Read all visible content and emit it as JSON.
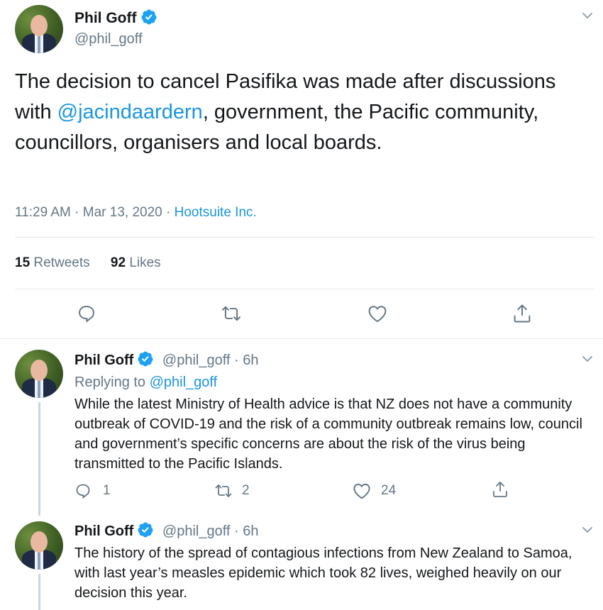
{
  "main_tweet": {
    "author_name": "Phil Goff",
    "handle": "@phil_goff",
    "text_before": "The decision to cancel Pasifika was made after discussions with ",
    "mention": "@jacindaardern",
    "text_after": ", government, the Pacific community, councillors, organisers and local boards.",
    "time": "11:29 AM",
    "date": "Mar 13, 2020",
    "separator": "·",
    "source": "Hootsuite Inc.",
    "retweets_count": "15",
    "retweets_label": "Retweets",
    "likes_count": "92",
    "likes_label": "Likes"
  },
  "replies": [
    {
      "author_name": "Phil Goff",
      "handle": "@phil_goff",
      "dot": "·",
      "age": "6h",
      "replying_label": "Replying to",
      "replying_handle": "@phil_goff",
      "text": "While the latest Ministry of Health advice is that NZ does not have a community outbreak of COVID-19 and the risk of a community outbreak remains low, council and government’s specific concerns are about the risk of the virus being transmitted to the Pacific Islands.",
      "reply_count": "1",
      "retweet_count": "2",
      "like_count": "24"
    },
    {
      "author_name": "Phil Goff",
      "handle": "@phil_goff",
      "dot": "·",
      "age": "6h",
      "text": "The history of the spread of contagious infections from New Zealand to Samoa, with last year’s measles epidemic which took 82 lives, weighed heavily on our decision this year."
    }
  ],
  "icons": [
    "chevron-down-icon",
    "verified-badge-icon",
    "reply-icon",
    "retweet-icon",
    "like-icon",
    "share-icon"
  ],
  "colors": {
    "link": "#1b95e0",
    "muted": "#657786",
    "verified": "#1da1f2",
    "divider": "#e6ecf0"
  }
}
